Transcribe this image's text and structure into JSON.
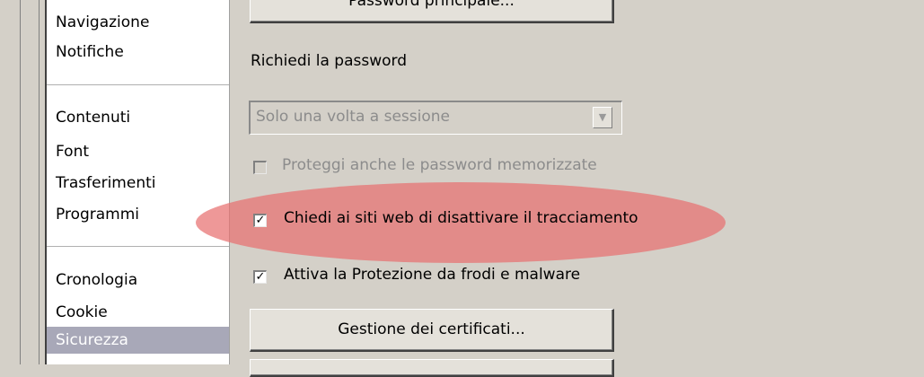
{
  "sidebar": {
    "items": [
      {
        "label": "Navigazione"
      },
      {
        "label": "Notifiche"
      },
      {
        "label": "Contenuti"
      },
      {
        "label": "Font"
      },
      {
        "label": "Trasferimenti"
      },
      {
        "label": "Programmi"
      },
      {
        "label": "Cronologia"
      },
      {
        "label": "Cookie"
      },
      {
        "label": "Sicurezza"
      }
    ],
    "selected": "Sicurezza"
  },
  "main": {
    "master_password_button": "Password principale...",
    "ask_password_label": "Richiedi la password",
    "ask_password_select": {
      "value": "Solo una volta a sessione",
      "enabled": false
    },
    "protect_saved_passwords": {
      "label": "Proteggi anche le password memorizzate",
      "checked": false,
      "enabled": false
    },
    "do_not_track": {
      "label": "Chiedi ai siti web di disattivare il tracciamento",
      "checked": true
    },
    "phishing_protection": {
      "label": "Attiva la Protezione da frodi e malware",
      "checked": true
    },
    "certificates_button": "Gestione dei certificati..."
  },
  "colors": {
    "highlight": "#e87070",
    "selected_row": "#a8a8b8"
  }
}
